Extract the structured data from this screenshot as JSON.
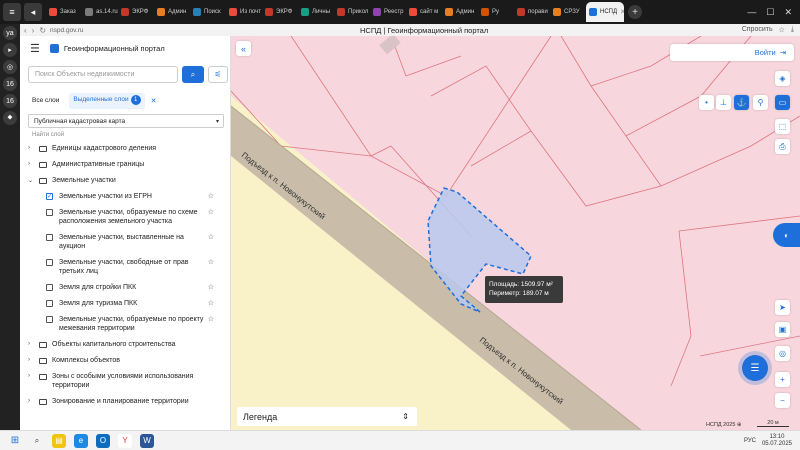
{
  "browser": {
    "tabs": [
      {
        "label": "Заказ",
        "color": "#e84c3d"
      },
      {
        "label": "as.14.ru",
        "color": "#7b7b7b"
      },
      {
        "label": "ЭКРФ",
        "color": "#c0392b"
      },
      {
        "label": "Админ",
        "color": "#e67e22"
      },
      {
        "label": "Поиск",
        "color": "#2980b9"
      },
      {
        "label": "Из почт",
        "color": "#e74c3c"
      },
      {
        "label": "ЭКРФ",
        "color": "#c0392b"
      },
      {
        "label": "Личны",
        "color": "#16a085"
      },
      {
        "label": "Прикол",
        "color": "#c0392b"
      },
      {
        "label": "Реестр",
        "color": "#8e44ad"
      },
      {
        "label": "сайт м",
        "color": "#e74c3c"
      },
      {
        "label": "Админ",
        "color": "#e67e22"
      },
      {
        "label": "Ру",
        "color": "#d35400"
      },
      {
        "label": "порави",
        "color": "#c0392b"
      },
      {
        "label": "СРЗУ",
        "color": "#e67e22"
      }
    ],
    "active_tab": {
      "label": "НСПД",
      "color": "#1e6fd9"
    },
    "url": "nspd.gov.ru",
    "page_title": "НСПД | Геоинформационный портал",
    "ask_label": "Спросить"
  },
  "rail": {
    "items": [
      "ya",
      "▸",
      "◎",
      "16",
      "16",
      "⬥"
    ]
  },
  "panel": {
    "title": "Геоинформационный портал",
    "search_placeholder": "Поиск Объекты недвижимости",
    "tab_all": "Все слои",
    "tab_selected": "Выделенные слои",
    "selected_count": "1",
    "basemap": "Публичная кадастровая карта",
    "find_layer": "Найти слой",
    "layers": [
      {
        "kind": "folder",
        "label": "Единицы кадастрового деления",
        "open": false
      },
      {
        "kind": "folder",
        "label": "Административные границы",
        "open": false
      },
      {
        "kind": "folder",
        "label": "Земельные участки",
        "open": true
      },
      {
        "kind": "item",
        "label": "Земельные участки из ЕГРН",
        "checked": true
      },
      {
        "kind": "item",
        "label": "Земельные участки, образуемые по схеме расположения земельного участка",
        "checked": false
      },
      {
        "kind": "item",
        "label": "Земельные участки, выставленные на аукцион",
        "checked": false
      },
      {
        "kind": "item",
        "label": "Земельные участки, свободные от прав третьих лиц",
        "checked": false
      },
      {
        "kind": "item",
        "label": "Земля для стройки ПКК",
        "checked": false
      },
      {
        "kind": "item",
        "label": "Земля для туризма ПКК",
        "checked": false
      },
      {
        "kind": "item",
        "label": "Земельные участки, образуемые по проекту межевания территории",
        "checked": false
      },
      {
        "kind": "folder",
        "label": "Объекты капитального строительства",
        "open": false
      },
      {
        "kind": "folder",
        "label": "Комплексы объектов",
        "open": false
      },
      {
        "kind": "folder",
        "label": "Зоны с особыми условиями использования территории",
        "open": false
      },
      {
        "kind": "folder",
        "label": "Зонирование и планирование территории",
        "open": false
      }
    ]
  },
  "map": {
    "login_label": "Войти",
    "road_label_1": "Подъезд к п. Новонукутский",
    "road_label_2": "Подъезд к п. Новонукутский",
    "tooltip_area": "Площадь: 1509.97 м²",
    "tooltip_perimeter": "Периметр: 189.07 м",
    "legend_label": "Легенда",
    "copyright": "НСПД 2025 ⊕",
    "scale": "20 м",
    "colors": {
      "parcel_fill": "#f7d7dd",
      "parcel_line": "#e0747f",
      "road": "#c9bca8",
      "zone": "#f9f2c9",
      "selection": "#b9c9ef",
      "selection_line": "#1e6fd9",
      "accent": "#1e6fd9"
    }
  },
  "taskbar": {
    "time": "13:10",
    "date": "05.07.2025",
    "lang": "РУС"
  }
}
